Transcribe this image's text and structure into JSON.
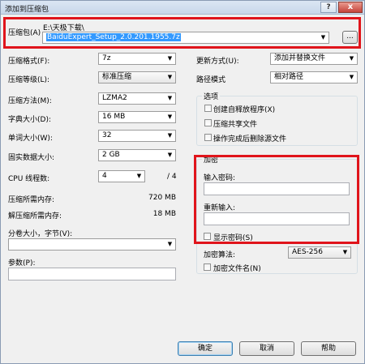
{
  "window": {
    "title": "添加到压缩包",
    "help_label": "?",
    "close_label": "x"
  },
  "archive": {
    "label": "压缩包(A)",
    "path_prefix": "E:\\天极下载\\",
    "filename": "BaiduExpert_Setup_2.0.201.1955.7z",
    "browse_label": "..."
  },
  "left": {
    "format_label": "压缩格式(F):",
    "format_value": "7z",
    "level_label": "压缩等级(L):",
    "level_value": "标准压缩",
    "method_label": "压缩方法(M):",
    "method_value": "LZMA2",
    "dict_label": "字典大小(D):",
    "dict_value": "16 MB",
    "word_label": "单词大小(W):",
    "word_value": "32",
    "solid_label": "固实数据大小:",
    "solid_value": "2 GB",
    "threads_label": "CPU 线程数:",
    "threads_value": "4",
    "threads_max": "/ 4",
    "mem_comp_label": "压缩所需内存:",
    "mem_comp_value": "720 MB",
    "mem_decomp_label": "解压缩所需内存:",
    "mem_decomp_value": "18 MB",
    "split_label": "分卷大小，字节(V):",
    "split_value": "",
    "params_label": "参数(P):",
    "params_value": ""
  },
  "right": {
    "update_label": "更新方式(U):",
    "update_value": "添加并替换文件",
    "pathmode_label": "路径模式",
    "pathmode_value": "相对路径",
    "options_title": "选项",
    "opt_sfx": "创建自释放程序(X)",
    "opt_shared": "压缩共享文件",
    "opt_delete": "操作完成后删除源文件"
  },
  "encryption": {
    "title": "加密",
    "password_label": "输入密码:",
    "reenter_label": "重新输入:",
    "show_password": "显示密码(S)",
    "method_label": "加密算法:",
    "method_value": "AES-256",
    "encrypt_names": "加密文件名(N)"
  },
  "buttons": {
    "ok": "确定",
    "cancel": "取消",
    "help": "帮助"
  },
  "icons": {
    "dropdown": "▼"
  },
  "colors": {
    "highlight": "#e0141b",
    "selection": "#3399ff"
  }
}
